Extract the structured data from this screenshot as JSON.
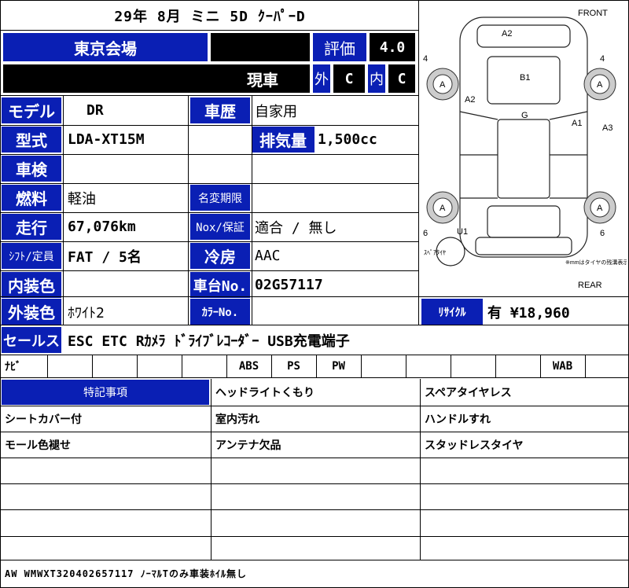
{
  "header": {
    "title": "29年 8月 ミニ 5D ｸｰﾊﾟｰD"
  },
  "venue": {
    "name": "東京会場",
    "rating_label": "評価",
    "rating": "4.0",
    "genshya": "現車",
    "gai_label": "外",
    "gai": "C",
    "nai_label": "内",
    "nai": "C"
  },
  "rows": {
    "model": {
      "label": "モデル",
      "value": "DR",
      "label2": "車歴",
      "value2": "自家用"
    },
    "type": {
      "label": "型式",
      "value": "LDA-XT15M",
      "label2": "排気量",
      "value2": "1,500cc"
    },
    "inspection": {
      "label": "車検",
      "value": ""
    },
    "fuel": {
      "label": "燃料",
      "value": "軽油",
      "label2": "名変期限",
      "value2": ""
    },
    "mileage": {
      "label": "走行",
      "value": "67,076km",
      "label2": "Nox/保証",
      "value2": "適合 / 無し"
    },
    "shift": {
      "label": "ｼﾌﾄ/定員",
      "value": "FAT / 5名",
      "label2": "冷房",
      "value2": "AAC"
    },
    "interior": {
      "label": "内装色",
      "value": "",
      "label2": "車台No.",
      "value2": "02G57117"
    },
    "exterior": {
      "label": "外装色",
      "value": "ﾎﾜｲﾄ2",
      "label2": "ｶﾗｰNo.",
      "value2": "",
      "label3": "ﾘｻｲｸﾙ",
      "value3": "有 ¥18,960"
    },
    "sales": {
      "label": "セールス",
      "value": "ESC ETC Rｶﾒﾗ ﾄﾞﾗｲﾌﾞﾚｺｰﾀﾞｰ USB充電端子"
    }
  },
  "equipment": [
    "ﾅﾋﾞ",
    "",
    "",
    "",
    "",
    "ABS",
    "PS",
    "PW",
    "",
    "",
    "",
    "",
    "WAB",
    ""
  ],
  "notes": {
    "header": "特記事項",
    "col2": [
      "ヘッドライトくもり",
      "室内汚れ",
      "アンテナ欠品",
      "",
      "",
      ""
    ],
    "col3": [
      "スペアタイヤレス",
      "ハンドルすれ",
      "スタッドレスタイヤ",
      "",
      "",
      ""
    ],
    "col1": [
      "",
      "シートカバー付",
      "モール色褪せ",
      "",
      "",
      ""
    ]
  },
  "footer": {
    "text": "AW WMWXT320402657117 ﾉｰﾏﾙTのみ車装ﾎｲﾙ無し"
  },
  "diagram": {
    "front": "FRONT",
    "rear": "REAR",
    "marks": [
      "A2",
      "B1",
      "A2",
      "G",
      "A1",
      "A3",
      "U1"
    ],
    "wheels": [
      "A",
      "A",
      "A",
      "A"
    ],
    "nums": [
      "4",
      "4",
      "6",
      "6"
    ],
    "spare": "ｽﾍﾟｱﾀｲﾔ",
    "note": "※mmはタイヤの残溝表示です"
  }
}
